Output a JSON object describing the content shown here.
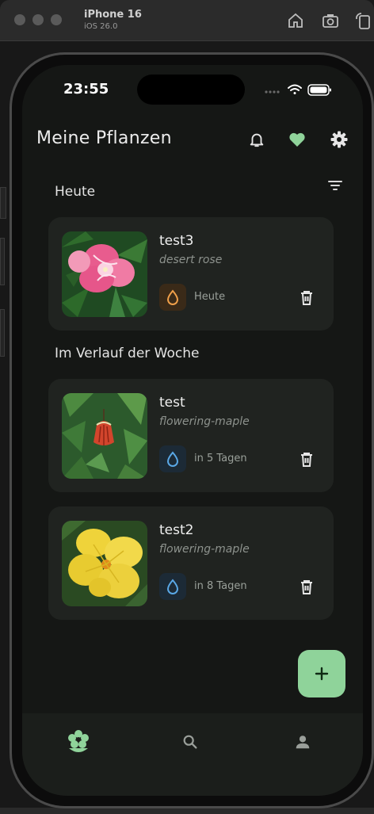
{
  "simulator": {
    "device_name": "iPhone 16",
    "os_version": "iOS 26.0",
    "tools": [
      "home-icon",
      "screenshot-icon",
      "rotate-icon"
    ]
  },
  "status_bar": {
    "time": "23:55"
  },
  "header": {
    "title": "Meine Pflanzen",
    "icons": [
      "bell-icon",
      "heart-icon",
      "gear-icon"
    ]
  },
  "sections": [
    {
      "title": "Heute",
      "plants": [
        {
          "name": "test3",
          "species": "desert rose",
          "due": "Heute",
          "urgent": true,
          "accent": "#f0a04a"
        }
      ]
    },
    {
      "title": "Im Verlauf der Woche",
      "plants": [
        {
          "name": "test",
          "species": "flowering-maple",
          "due": "in 5 Tagen",
          "urgent": false,
          "accent": "#5aa8e6"
        },
        {
          "name": "test2",
          "species": "flowering-maple",
          "due": "in 8 Tagen",
          "urgent": false,
          "accent": "#5aa8e6"
        }
      ]
    }
  ],
  "fab_icon": "plus-icon",
  "nav": {
    "items": [
      "plants-icon",
      "search-icon",
      "profile-icon"
    ],
    "active": "plants-icon",
    "active_color": "#8fd39a"
  },
  "colors": {
    "background": "#151715",
    "card": "#202320",
    "accent_green": "#8fd39a"
  }
}
